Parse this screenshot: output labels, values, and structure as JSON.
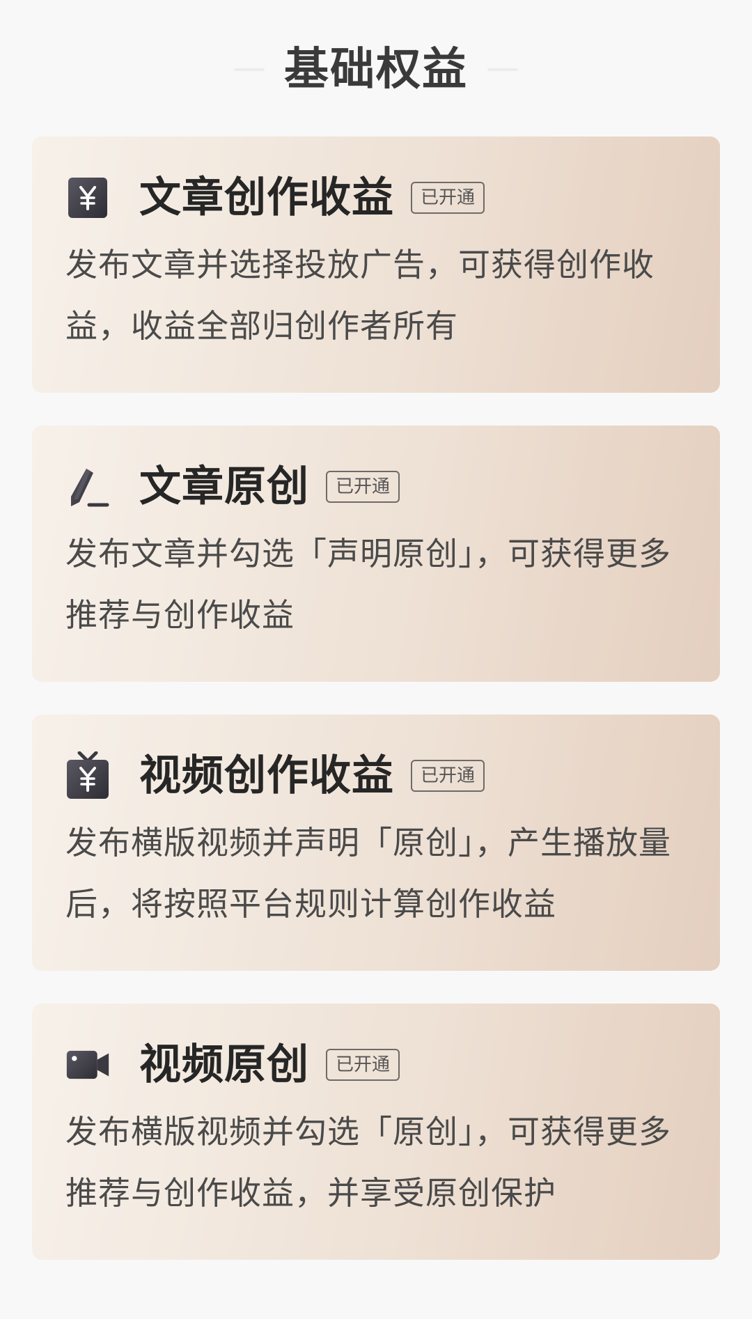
{
  "section": {
    "title": "基础权益"
  },
  "cards": [
    {
      "icon": "yen-coin-icon",
      "title": "文章创作收益",
      "badge": "已开通",
      "desc": "发布文章并选择投放广告，可获得创作收益，收益全部归创作者所有"
    },
    {
      "icon": "pen-edit-icon",
      "title": "文章原创",
      "badge": "已开通",
      "desc": "发布文章并勾选「声明原创」，可获得更多推荐与创作收益"
    },
    {
      "icon": "tv-yen-icon",
      "title": "视频创作收益",
      "badge": "已开通",
      "desc": "发布横版视频并声明「原创」，产生播放量后，将按照平台规则计算创作收益"
    },
    {
      "icon": "video-camera-icon",
      "title": "视频原创",
      "badge": "已开通",
      "desc": "发布横版视频并勾选「原创」，可获得更多推荐与创作收益，并享受原创保护"
    }
  ],
  "colors": {
    "icon": "#4a4850",
    "title": "#262626",
    "text": "#4a4a4a",
    "card_gradient_start": "#f7f1ea",
    "card_gradient_end": "#e4cfbf"
  }
}
